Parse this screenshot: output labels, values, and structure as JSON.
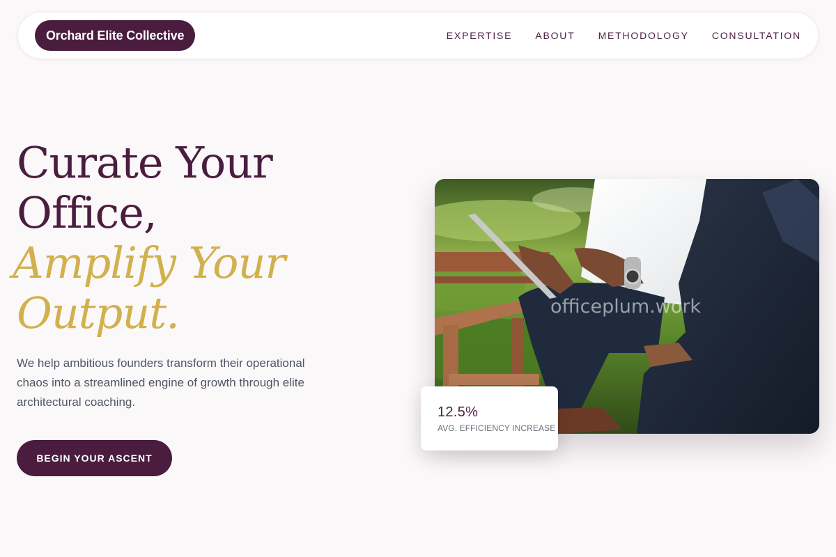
{
  "brand": {
    "name": "Orchard Elite Collective"
  },
  "nav": {
    "links": [
      {
        "label": "EXPERTISE"
      },
      {
        "label": "ABOUT"
      },
      {
        "label": "METHODOLOGY"
      },
      {
        "label": "CONSULTATION"
      }
    ]
  },
  "hero": {
    "headline_line1": "Curate Your",
    "headline_line2": "Office,",
    "accent_line1": "Amplify Your",
    "accent_line2": "Output.",
    "description": "We help ambitious founders transform their operational chaos into a streamlined engine of growth through elite architectural coaching.",
    "cta_label": "BEGIN YOUR ASCENT"
  },
  "image": {
    "watermark": "officeplum.work"
  },
  "stat": {
    "value": "12.5%",
    "label": "AVG. EFFICIENCY INCREASE"
  },
  "colors": {
    "primary": "#4a1d3f",
    "accent": "#d2b04c",
    "background": "#fbf8f9"
  }
}
